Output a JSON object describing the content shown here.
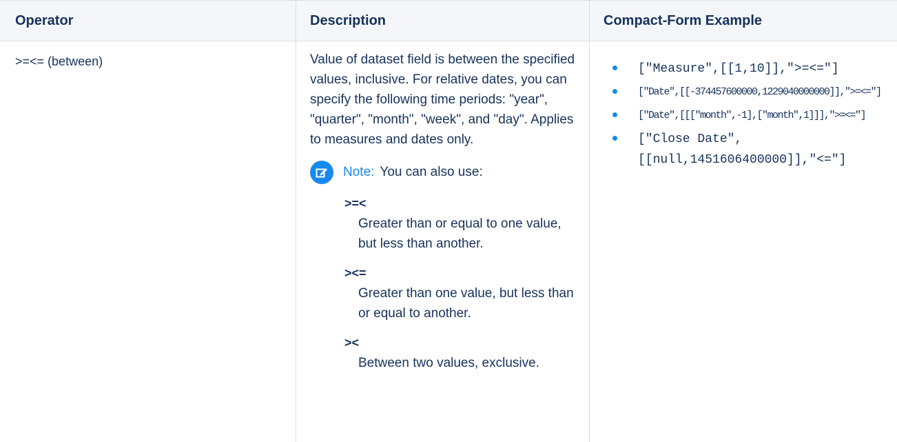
{
  "header": {
    "operator": "Operator",
    "description": "Description",
    "example": "Compact-Form Example"
  },
  "row": {
    "operator": ">=<= (between)",
    "description": "Value of dataset field is between the specified values, inclusive. For relative dates, you can specify the following time periods: \"year\", \"quarter\", \"month\", \"week\", and \"day\". Applies to measures and dates only.",
    "note_label": "Note:",
    "note_text": "You can also use:",
    "note_items": [
      {
        "term": ">=<",
        "definition": "Greater than or equal to one value, but less than another."
      },
      {
        "term": "><=",
        "definition": "Greater than one value, but less than or equal to another."
      },
      {
        "term": "><",
        "definition": "Between two values, exclusive."
      }
    ],
    "examples": [
      "[\"Measure\",[[1,10]],\">=<=\"]",
      "[\"Date\",[[-374457600000,1229040000000]],\">=<=\"]",
      "[\"Date\",[[[\"month\",-1],[\"month\",1]]],\">=<=\"]",
      "[\"Close Date\", [[null,1451606400000]],\"<=\"]"
    ]
  },
  "colors": {
    "accent": "#1589ee",
    "text": "#16325c",
    "header_bg": "#f4f6f9",
    "border": "#d8dde6"
  },
  "icons": {
    "note": "edit-note-icon"
  }
}
